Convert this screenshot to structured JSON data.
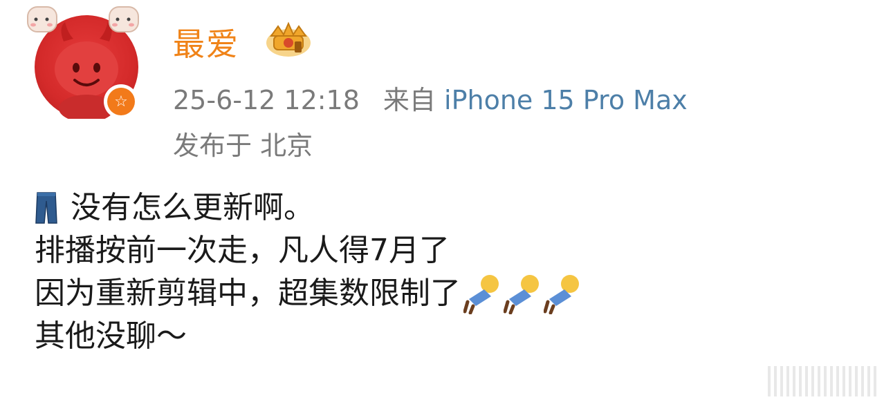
{
  "header": {
    "username": "最爱",
    "timestamp": "25-6-12 12:18",
    "source": "来自",
    "device": "iPhone 15 Pro Max",
    "location": "发布于 北京"
  },
  "post": {
    "line1": "没有怎么更新啊。",
    "line2": "排播按前一次走，凡人得7月了",
    "line3": "因为重新剪辑中，超集数限制了",
    "line4": "其他没聊～"
  },
  "icons": {
    "avatar": "red-devil-avatar",
    "vip_badge": "crown-badge-icon",
    "verified_badge": "star-badge-icon",
    "line1_emoji": "jeans-icon",
    "line3_emoji": "person-lying-icon"
  },
  "colors": {
    "username": "#f08318",
    "meta": "#7a7a7a",
    "device_link": "#4d7fa8",
    "avatar_red": "#d42a2a",
    "badge_orange": "#f27a1a"
  }
}
